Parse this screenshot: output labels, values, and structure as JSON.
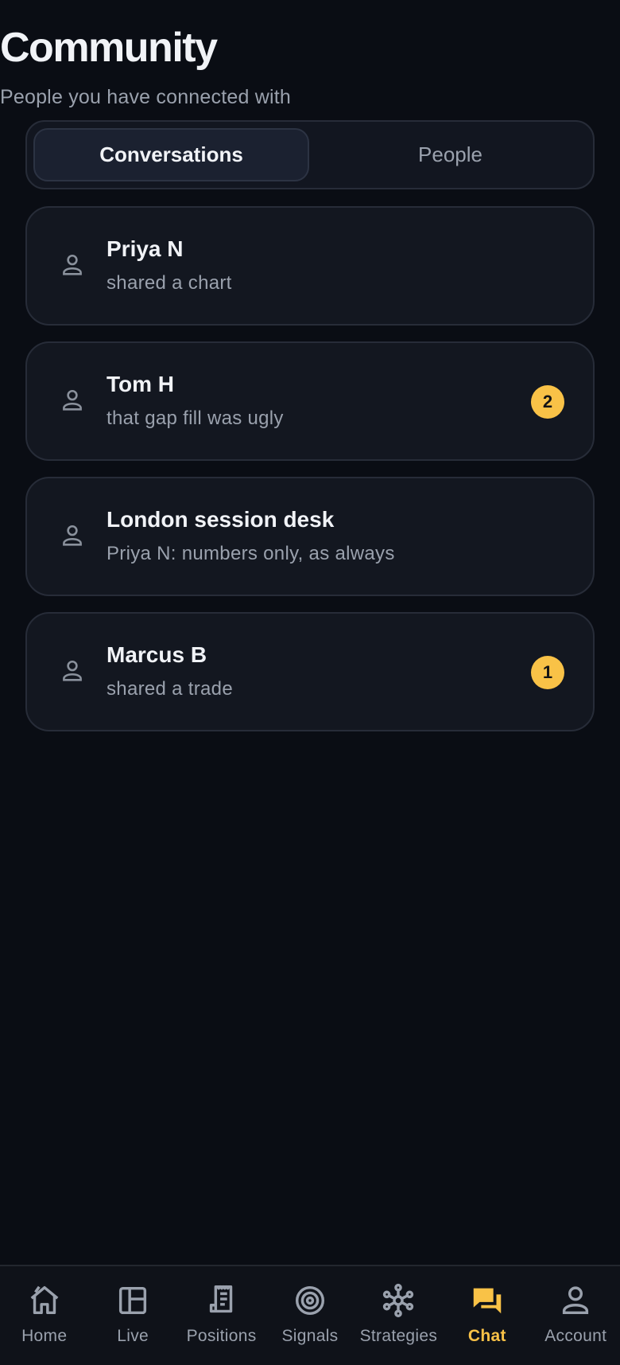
{
  "header": {
    "title": "Community",
    "subtitle": "People you have connected with"
  },
  "tabs": [
    {
      "label": "Conversations",
      "active": true
    },
    {
      "label": "People",
      "active": false
    }
  ],
  "conversations": [
    {
      "name": "Priya N",
      "preview": "shared a chart",
      "unread": null,
      "icon": "person-icon"
    },
    {
      "name": "Tom H",
      "preview": "that gap fill was ugly",
      "unread": "2",
      "icon": "person-icon"
    },
    {
      "name": "London session desk",
      "preview": "Priya N: numbers only, as always",
      "unread": null,
      "icon": "person-icon"
    },
    {
      "name": "Marcus B",
      "preview": "shared a trade",
      "unread": "1",
      "icon": "person-icon"
    }
  ],
  "bottom_nav": [
    {
      "label": "Home",
      "icon": "home-icon",
      "active": false
    },
    {
      "label": "Live",
      "icon": "layout-icon",
      "active": false
    },
    {
      "label": "Positions",
      "icon": "receipt-icon",
      "active": false
    },
    {
      "label": "Signals",
      "icon": "at-sign-icon",
      "active": false
    },
    {
      "label": "Strategies",
      "icon": "network-icon",
      "active": false
    },
    {
      "label": "Chat",
      "icon": "chat-icon",
      "active": true
    },
    {
      "label": "Account",
      "icon": "person-icon",
      "active": false
    }
  ],
  "colors": {
    "background": "#0a0d14",
    "card": "#131720",
    "accent": "#f9c247",
    "muted_text": "#9aa1ad"
  }
}
